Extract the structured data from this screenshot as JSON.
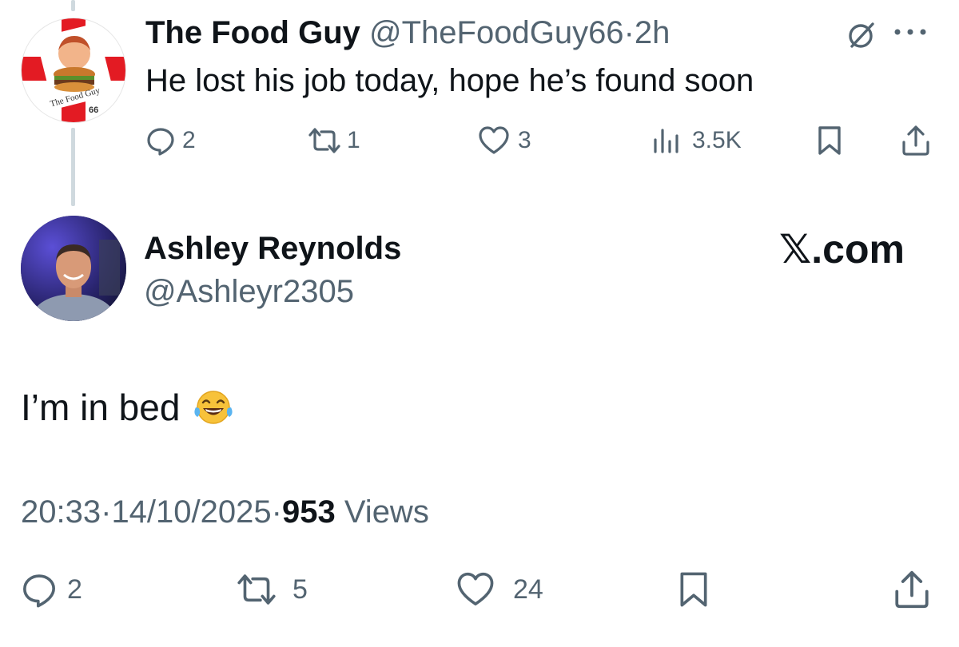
{
  "parent_tweet": {
    "display_name": "The Food Guy",
    "handle": "@TheFoodGuy66",
    "separator": "·",
    "time": "2h",
    "text": "He lost his job today, hope he’s found soon",
    "avatar_logo_text": "The Food Guy 66",
    "actions": {
      "replies": "2",
      "reposts": "1",
      "likes": "3",
      "views": "3.5K"
    }
  },
  "reply_tweet": {
    "display_name": "Ashley Reynolds",
    "handle": "@Ashleyr2305",
    "text": "I’m in bed",
    "emoji": "😂",
    "time": "20:33",
    "date": "14/10/2025",
    "separator": "·",
    "views_count": "953",
    "views_label": "Views",
    "actions": {
      "replies": "2",
      "reposts": "5",
      "likes": "24"
    }
  },
  "watermark": "𝕏.com",
  "colors": {
    "text": "#0f1419",
    "muted": "#536471",
    "thread_line": "#cfd9de",
    "emoji_yellow": "#f7c23a",
    "logo_red": "#e31b23"
  },
  "icons": [
    "grok-icon",
    "more-icon",
    "reply-icon",
    "repost-icon",
    "like-icon",
    "views-icon",
    "bookmark-icon",
    "share-icon"
  ]
}
